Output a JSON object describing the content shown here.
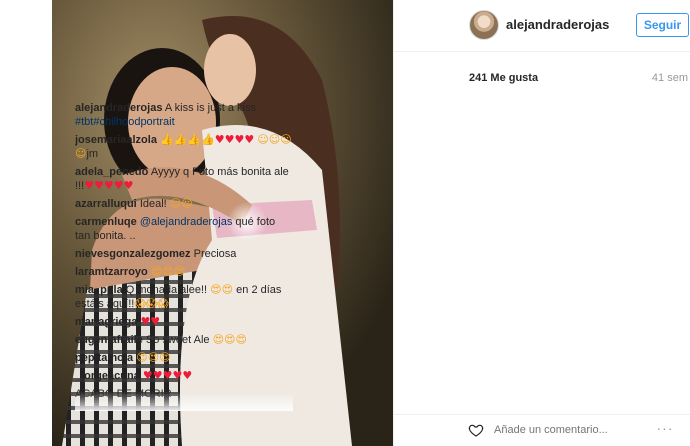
{
  "post": {
    "username": "alejandraderojas",
    "follow_label": "Seguir",
    "likes": "241 Me gusta",
    "time_ago": "41 sem"
  },
  "caption": {
    "user": "alejandraderojas",
    "text": "A kiss is just a kiss",
    "hashtags": "#tbt#chilhoodportrait"
  },
  "comments": [
    {
      "user": "josemariaalzola",
      "text": "",
      "tail": "jm"
    },
    {
      "user": "adela_penedo",
      "text": "Ayyyy q Foto más bonita ale !!!"
    },
    {
      "user": "azarralluqui",
      "text": "Ideal!"
    },
    {
      "user": "carmenluqe",
      "mention": "@alejandraderojas",
      "text": "qué foto tan bonita. .."
    },
    {
      "user": "nievesgonzalezgomez",
      "text": "Preciosa"
    },
    {
      "user": "laramtzarroyo",
      "text": ""
    },
    {
      "user": "mia_ppla",
      "text": "Q monada alee!!",
      "text2": "en 2 días estáis aquí!!"
    },
    {
      "user": "mariagriega",
      "text": ""
    },
    {
      "user": "eugeniafraile",
      "text": "So sweet Ale"
    },
    {
      "user": "pepitamola",
      "text": ""
    },
    {
      "user": "_jorgeacuna",
      "text": ""
    },
    {
      "user": "",
      "text": "ACABO DE MORIR"
    }
  ],
  "footer": {
    "comment_placeholder": "Añade un comentario...",
    "more_label": "···"
  },
  "icons": {
    "heart": "heart-icon",
    "more": "more-options-icon",
    "avatar": "avatar"
  },
  "colors": {
    "link": "#003569",
    "follow_blue": "#3897f0",
    "heart_red": "#ed1c3a"
  }
}
